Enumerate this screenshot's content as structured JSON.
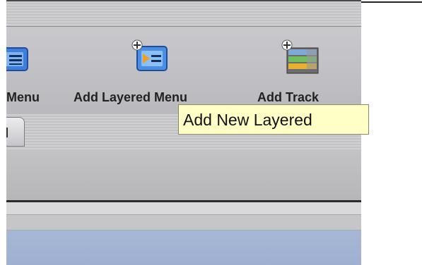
{
  "toolbar": {
    "items": [
      {
        "label": "Menu",
        "icon": "menu-icon"
      },
      {
        "label": "Add Layered Menu",
        "icon": "add-layered-menu-icon"
      },
      {
        "label": "Add Track",
        "icon": "add-track-icon"
      }
    ]
  },
  "tooltip": {
    "text": "Add New Layered"
  },
  "colors": {
    "toolbar_bg": "#c0c0c4",
    "tooltip_bg": "#ffffc6",
    "accent_blue": "#a3b3d3"
  }
}
